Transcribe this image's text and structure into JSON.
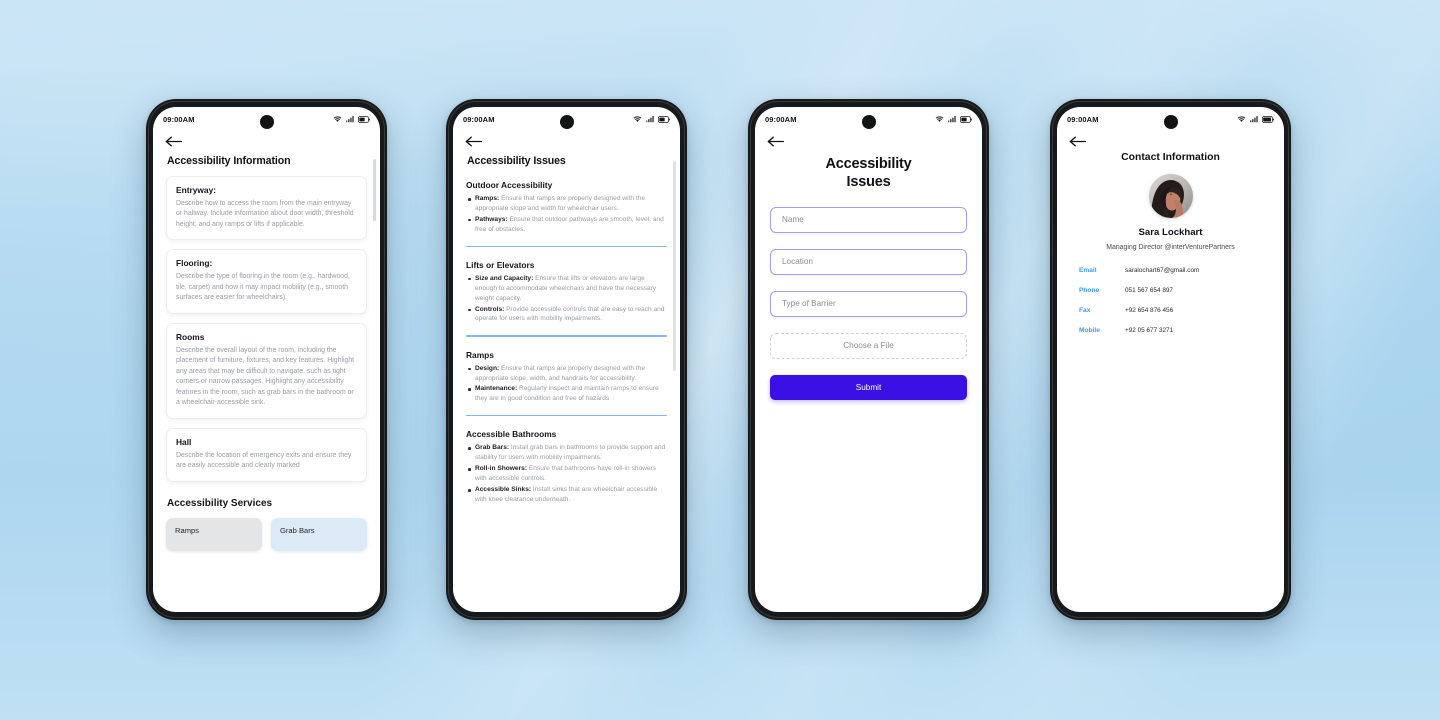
{
  "background": {
    "base_color": "#b9dcf1",
    "accent_color": "#3a10e5"
  },
  "phones": [
    {
      "id": "phone-accessibility-information",
      "status_bar": {
        "time": "09:00AM",
        "icons": [
          "wifi-icon",
          "signal-icon",
          "battery-icon"
        ]
      },
      "back_label": "back-arrow",
      "title": "Accessibility Information",
      "cards": [
        {
          "title": "Entryway:",
          "body": "Describe how to access the room from the main entryway or hallway. Include information about door width, threshold height, and any ramps or lifts if applicable."
        },
        {
          "title": "Flooring:",
          "body": "Describe the type of flooring in the room (e.g., hardwood, tile, carpet) and how it may impact mobility (e.g., smooth surfaces are easier for wheelchairs)."
        },
        {
          "title": "Rooms",
          "body": "Describe the overall layout of the room, including the placement of furniture, fixtures, and key features. Highlight any areas that may be difficult to navigate, such as tight corners or narrow passages. Highlight any accessibility features in the room, such as grab bars in the bathroom or a wheelchair-accessible sink."
        },
        {
          "title": "Hall",
          "body": "Describe the location of emergency exits and ensure they are easily accessible and clearly marked"
        }
      ],
      "services_heading": "Accessibility Services",
      "services": [
        {
          "label": "Ramps",
          "color": "#e4e5e7"
        },
        {
          "label": "Grab Bars",
          "color": "#dce9f6"
        }
      ]
    },
    {
      "id": "phone-accessibility-issues-list",
      "status_bar": {
        "time": "09:00AM",
        "icons": [
          "wifi-icon",
          "signal-icon",
          "battery-icon"
        ]
      },
      "title": "Accessibility Issues",
      "sections": [
        {
          "heading": "Outdoor Accessibility",
          "items": [
            {
              "term": "Ramps:",
              "text": " Ensure that ramps are properly designed with the appropriate slope and width for wheelchair users."
            },
            {
              "term": "Pathways:",
              "text": " Ensure that outdoor pathways are smooth, level, and free of obstacles."
            }
          ]
        },
        {
          "heading": "Lifts or Elevators",
          "items": [
            {
              "term": "Size and Capacity:",
              "text": " Ensure that lifts or elevators are large enough to accommodate wheelchairs and have the necessary weight capacity."
            },
            {
              "term": "Controls:",
              "text": " Provide accessible controls that are easy to reach and operate for users with mobility impairments."
            }
          ]
        },
        {
          "heading": "Ramps",
          "items": [
            {
              "term": "Design:",
              "text": " Ensure that ramps are properly designed with the appropriate slope, width, and handrails for accessibility."
            },
            {
              "term": "Maintenance:",
              "text": " Regularly inspect and maintain ramps to ensure they are in good condition and free of hazards"
            }
          ]
        },
        {
          "heading": "Accessible Bathrooms",
          "items": [
            {
              "term": "Grab Bars:",
              "text": " Install grab bars in bathrooms to provide support and stability for users with mobility impairments."
            },
            {
              "term": "Roll-in Showers:",
              "text": " Ensure that bathrooms have roll-in showers with accessible controls."
            },
            {
              "term": "Accessible Sinks:",
              "text": " Install sinks that are wheelchair accessible with knee clearance underneath."
            }
          ]
        }
      ]
    },
    {
      "id": "phone-report-form",
      "status_bar": {
        "time": "09:00AM",
        "icons": [
          "wifi-icon",
          "signal-icon",
          "battery-icon"
        ]
      },
      "title_line1": "Accessibility",
      "title_line2": "Issues",
      "fields": [
        {
          "name": "name",
          "placeholder": "Name",
          "value": ""
        },
        {
          "name": "location",
          "placeholder": "Location",
          "value": ""
        },
        {
          "name": "type_of_barrier",
          "placeholder": "Type of Barrier",
          "value": ""
        }
      ],
      "file_label": "Choose a File",
      "submit_label": "Submit"
    },
    {
      "id": "phone-contact-information",
      "status_bar": {
        "time": "09:00AM",
        "icons": [
          "wifi-icon",
          "signal-icon",
          "battery-icon"
        ]
      },
      "title": "Contact Information",
      "avatar_alt": "profile-photo",
      "name": "Sara Lockhart",
      "role": "Managing Director  @interVenturePartners",
      "contacts": [
        {
          "label": "Email",
          "value": "saralochart67@gmail.com"
        },
        {
          "label": "Phone",
          "value": "051 567 654 897"
        },
        {
          "label": "Fax",
          "value": "+92 654 876 456"
        },
        {
          "label": "Mobile",
          "value": "+92 05 677 3271"
        }
      ]
    }
  ]
}
